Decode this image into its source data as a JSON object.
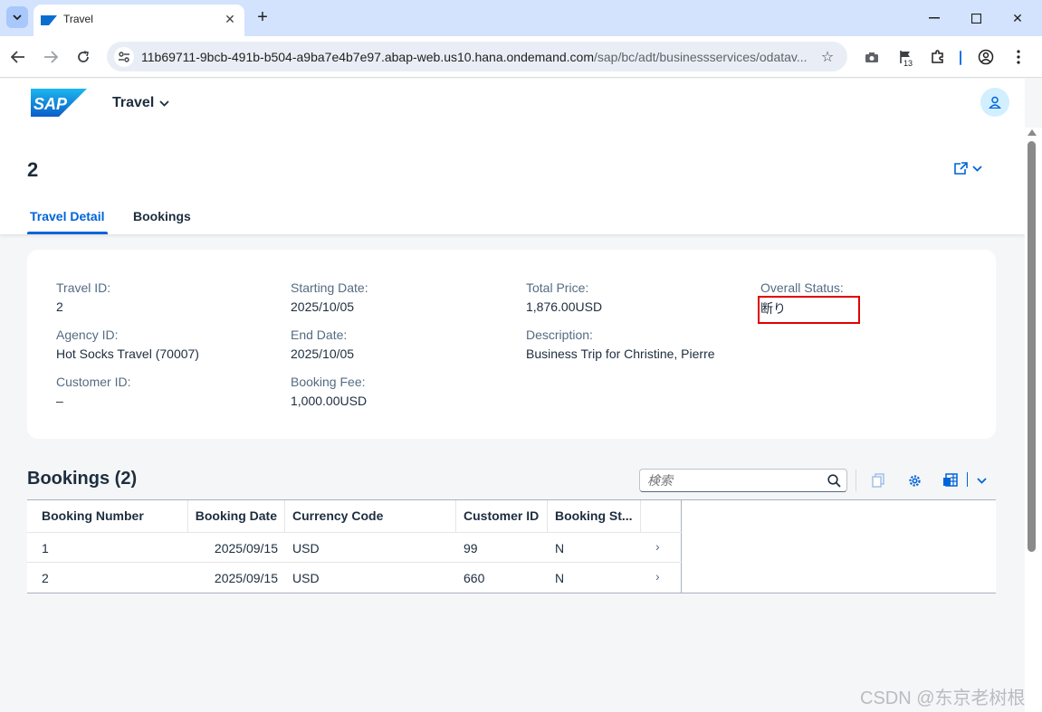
{
  "browser": {
    "tab_title": "Travel",
    "url_host": "11b69711-9bcb-491b-b504-a9ba7e4b7e97.abap-web.us10.hana.ondemand.com",
    "url_path": "/sap/bc/adt/businessservices/odatav...",
    "extension_badge": "13"
  },
  "shell": {
    "logo_text": "SAP",
    "app_title": "Travel"
  },
  "header": {
    "object_title": "2",
    "tabs": [
      {
        "label": "Travel Detail",
        "active": true
      },
      {
        "label": "Bookings",
        "active": false
      }
    ]
  },
  "details": {
    "travel_id": {
      "label": "Travel ID:",
      "value": "2"
    },
    "agency_id": {
      "label": "Agency ID:",
      "value": "Hot Socks Travel (70007)"
    },
    "customer_id": {
      "label": "Customer ID:",
      "value": "–"
    },
    "starting_date": {
      "label": "Starting Date:",
      "value": "2025/10/05"
    },
    "end_date": {
      "label": "End Date:",
      "value": "2025/10/05"
    },
    "booking_fee": {
      "label": "Booking Fee:",
      "value": "1,000.00USD"
    },
    "total_price": {
      "label": "Total Price:",
      "value": "1,876.00USD"
    },
    "description": {
      "label": "Description:",
      "value": "Business Trip for Christine, Pierre"
    },
    "overall_status": {
      "label": "Overall Status:",
      "value": "断り"
    }
  },
  "bookings": {
    "title": "Bookings (2)",
    "search_placeholder": "検索",
    "columns": [
      "Booking Number",
      "Booking Date",
      "Currency Code",
      "Customer ID",
      "Booking St..."
    ],
    "rows": [
      {
        "booking_number": "1",
        "booking_date": "2025/09/15",
        "currency": "USD",
        "customer_id": "99",
        "status": "N"
      },
      {
        "booking_number": "2",
        "booking_date": "2025/09/15",
        "currency": "USD",
        "customer_id": "660",
        "status": "N"
      }
    ]
  },
  "watermark": "CSDN @东京老树根",
  "colors": {
    "accent": "#0064d9",
    "highlight_border": "#e00000",
    "page_background": "#f5f6f7"
  }
}
